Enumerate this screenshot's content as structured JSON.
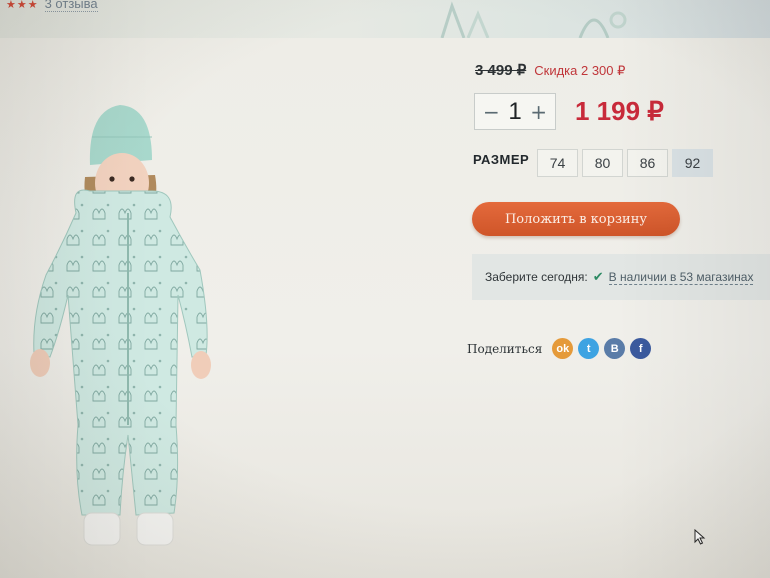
{
  "rating": {
    "stars": "★★★",
    "reviews_label": "3 отзыва"
  },
  "product": {
    "old_price": "3 499 ₽",
    "discount": "Скидка 2 300 ₽",
    "quantity": "1",
    "qty_minus": "−",
    "qty_plus": "+",
    "price": "1 199 ₽"
  },
  "size": {
    "label": "РАЗМЕР",
    "options": [
      "74",
      "80",
      "86",
      "92"
    ],
    "selected": "92"
  },
  "cart": {
    "button_label": "Положить в корзину"
  },
  "pickup": {
    "label": "Заберите сегодня:",
    "check": "✔",
    "stores_link": "В наличии в 53 магазинах"
  },
  "share": {
    "label": "Поделиться",
    "networks": [
      {
        "icon": "odnoklassniki-icon",
        "glyph": "ok"
      },
      {
        "icon": "twitter-icon",
        "glyph": "t"
      },
      {
        "icon": "vk-icon",
        "glyph": "B"
      },
      {
        "icon": "facebook-icon",
        "glyph": "f"
      }
    ]
  },
  "colors": {
    "price_red": "#c82a3a",
    "cart_orange": "#dd6030",
    "check_green": "#2c8a63",
    "selected_size_bg": "#d9e1e4"
  }
}
